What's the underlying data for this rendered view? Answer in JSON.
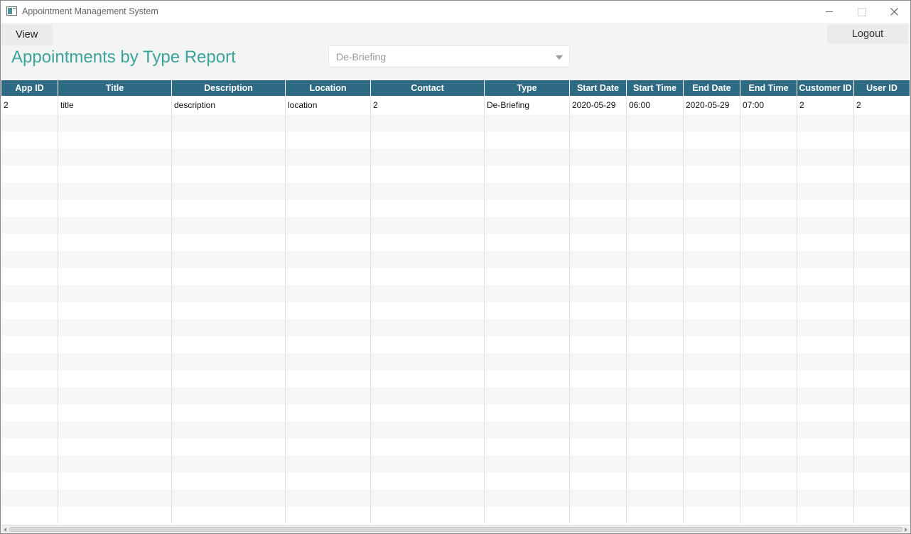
{
  "window": {
    "title": "Appointment Management System"
  },
  "toolbar": {
    "view_menu_label": "View",
    "logout_label": "Logout"
  },
  "page": {
    "title": "Appointments by Type Report"
  },
  "type_filter": {
    "selected": "De-Briefing"
  },
  "table": {
    "columns": [
      "App ID",
      "Title",
      "Description",
      "Location",
      "Contact",
      "Type",
      "Start Date",
      "Start Time",
      "End Date",
      "End Time",
      "Customer ID",
      "User ID"
    ],
    "rows": [
      [
        "2",
        "title",
        "description",
        "location",
        "2",
        "De-Briefing",
        "2020-05-29",
        "06:00",
        "2020-05-29",
        "07:00",
        "2",
        "2"
      ]
    ]
  },
  "colors": {
    "accent_title": "#3aa59a",
    "header_bg": "#2e6a84"
  },
  "icons": {
    "close": "close-icon",
    "minimize": "minimize-icon",
    "maximize": "maximize-icon",
    "dropdown": "chevron-down-icon",
    "app": "app-icon"
  }
}
